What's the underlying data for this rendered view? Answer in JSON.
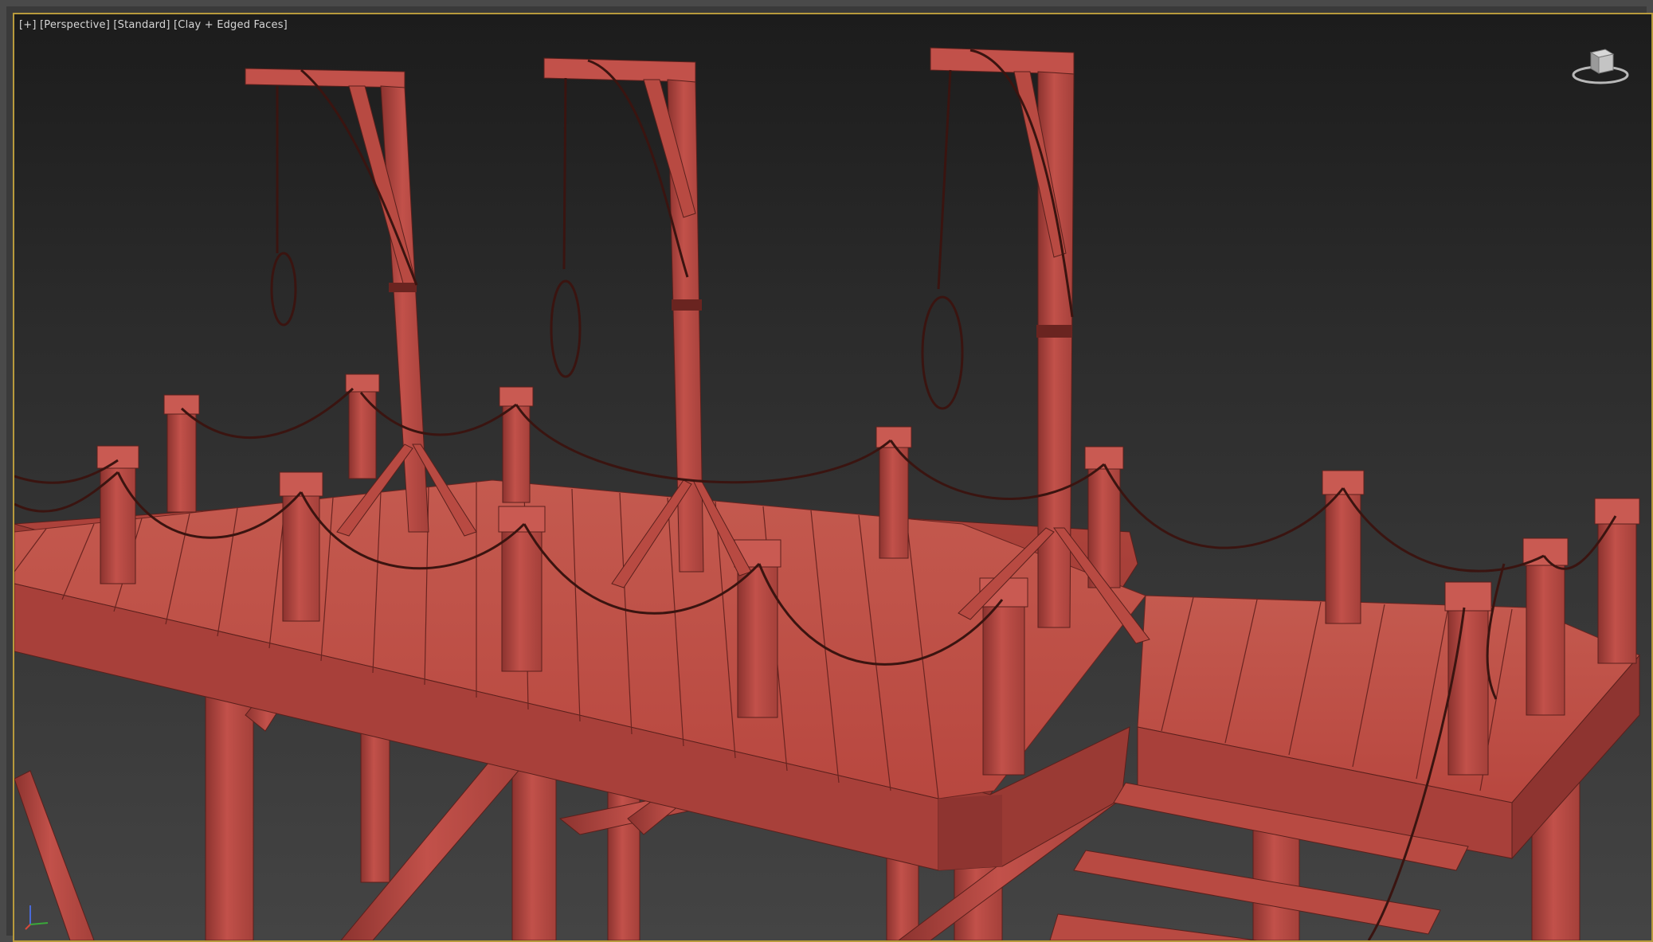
{
  "viewport": {
    "label_plus": "[+]",
    "label_view": "[Perspective]",
    "label_mode": "[Standard]",
    "label_shading": "[Clay + Edged Faces]"
  },
  "colors": {
    "clay": "#c2514a",
    "clay_dark": "#8c332f",
    "rope": "#3a1410",
    "viewport_border": "#b89a3c"
  },
  "icons": {
    "viewcube": "viewcube-icon",
    "axis_tripod": "axis-tripod-icon"
  }
}
